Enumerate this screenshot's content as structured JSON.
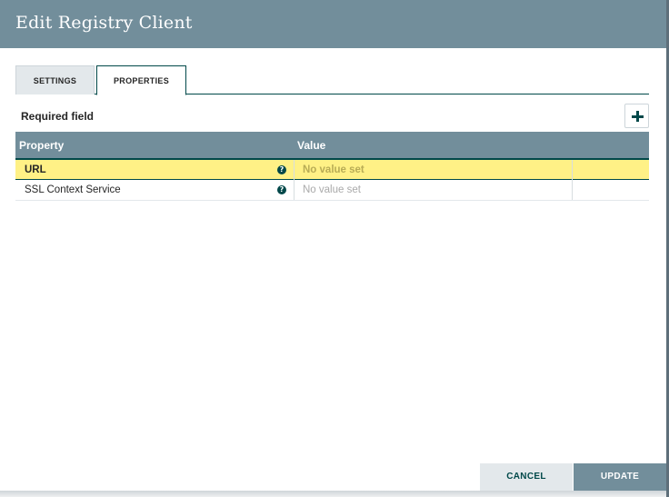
{
  "dialog": {
    "title": "Edit Registry Client"
  },
  "tabs": [
    {
      "label": "SETTINGS",
      "active": false
    },
    {
      "label": "PROPERTIES",
      "active": true
    }
  ],
  "properties": {
    "required_label": "Required field",
    "add_icon": "plus-icon",
    "columns": {
      "property": "Property",
      "value": "Value"
    },
    "rows": [
      {
        "name": "URL",
        "value": "No value set",
        "help_icon": "question-circle-icon",
        "selected": true
      },
      {
        "name": "SSL Context Service",
        "value": "No value set",
        "help_icon": "question-circle-icon",
        "selected": false
      }
    ]
  },
  "footer": {
    "cancel_label": "CANCEL",
    "update_label": "UPDATE"
  },
  "colors": {
    "header_bg": "#728e9b",
    "accent_dark": "#004849",
    "selected_row": "#fff186",
    "tab_inactive_bg": "#e3e8eb"
  }
}
